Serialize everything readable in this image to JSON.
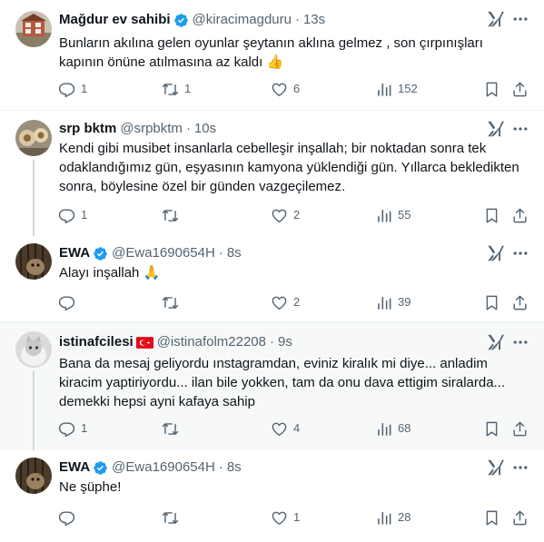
{
  "tweets": [
    {
      "name": "Mağdur ev sahibi",
      "handle": "@kiracimagduru",
      "time": "13s",
      "text_lines": [
        "Bunların akılına gelen oyunlar şeytanın aklına gelmez , son çırpınışları",
        "kapının önüne atılmasına az kaldı 👍"
      ],
      "replies": "1",
      "reposts": "1",
      "likes": "6",
      "views": "152"
    },
    {
      "name": "srp bktm",
      "handle": "@srpbktm",
      "time": "10s",
      "text_lines": [
        "Kendi gibi musibet insanlarla cebelleşir inşallah; bir noktadan sonra tek",
        "odaklandığımız gün, eşyasının kamyona yüklendiği gün. Yıllarca bekledikten",
        "sonra, böylesine özel bir günden vazgeçilemez."
      ],
      "replies": "1",
      "reposts": "",
      "likes": "2",
      "views": "55"
    },
    {
      "name": "EWA",
      "handle": "@Ewa1690654H",
      "time": "8s",
      "text_lines": [
        "Alayı inşallah 🙏"
      ],
      "replies": "",
      "reposts": "",
      "likes": "2",
      "views": "39"
    },
    {
      "name": "istinafcilesi",
      "handle": "@istinafolm22208",
      "time": "9s",
      "text_lines": [
        "Bana da mesaj geliyordu ınstagramdan, eviniz kiralık mi diye... anladim",
        "kiracim yaptiriyordu... ilan bile yokken, tam da onu dava ettigim siralarda...",
        "demekki hepsi ayni kafaya sahip"
      ],
      "replies": "1",
      "reposts": "",
      "likes": "4",
      "views": "68"
    },
    {
      "name": "EWA",
      "handle": "@Ewa1690654H",
      "time": "8s",
      "text_lines": [
        "Ne şüphe!"
      ],
      "replies": "",
      "reposts": "",
      "likes": "1",
      "views": "28"
    }
  ],
  "dot": "·",
  "colors": {
    "verified": "#1d9bf0",
    "secondary_text": "#536471",
    "highlight_bg": "#f7f9f9"
  },
  "icons": [
    "verified-badge-icon",
    "turkey-flag-icon",
    "grok-icon",
    "more-icon",
    "reply-icon",
    "repost-icon",
    "like-icon",
    "views-icon",
    "bookmark-icon",
    "share-icon"
  ]
}
